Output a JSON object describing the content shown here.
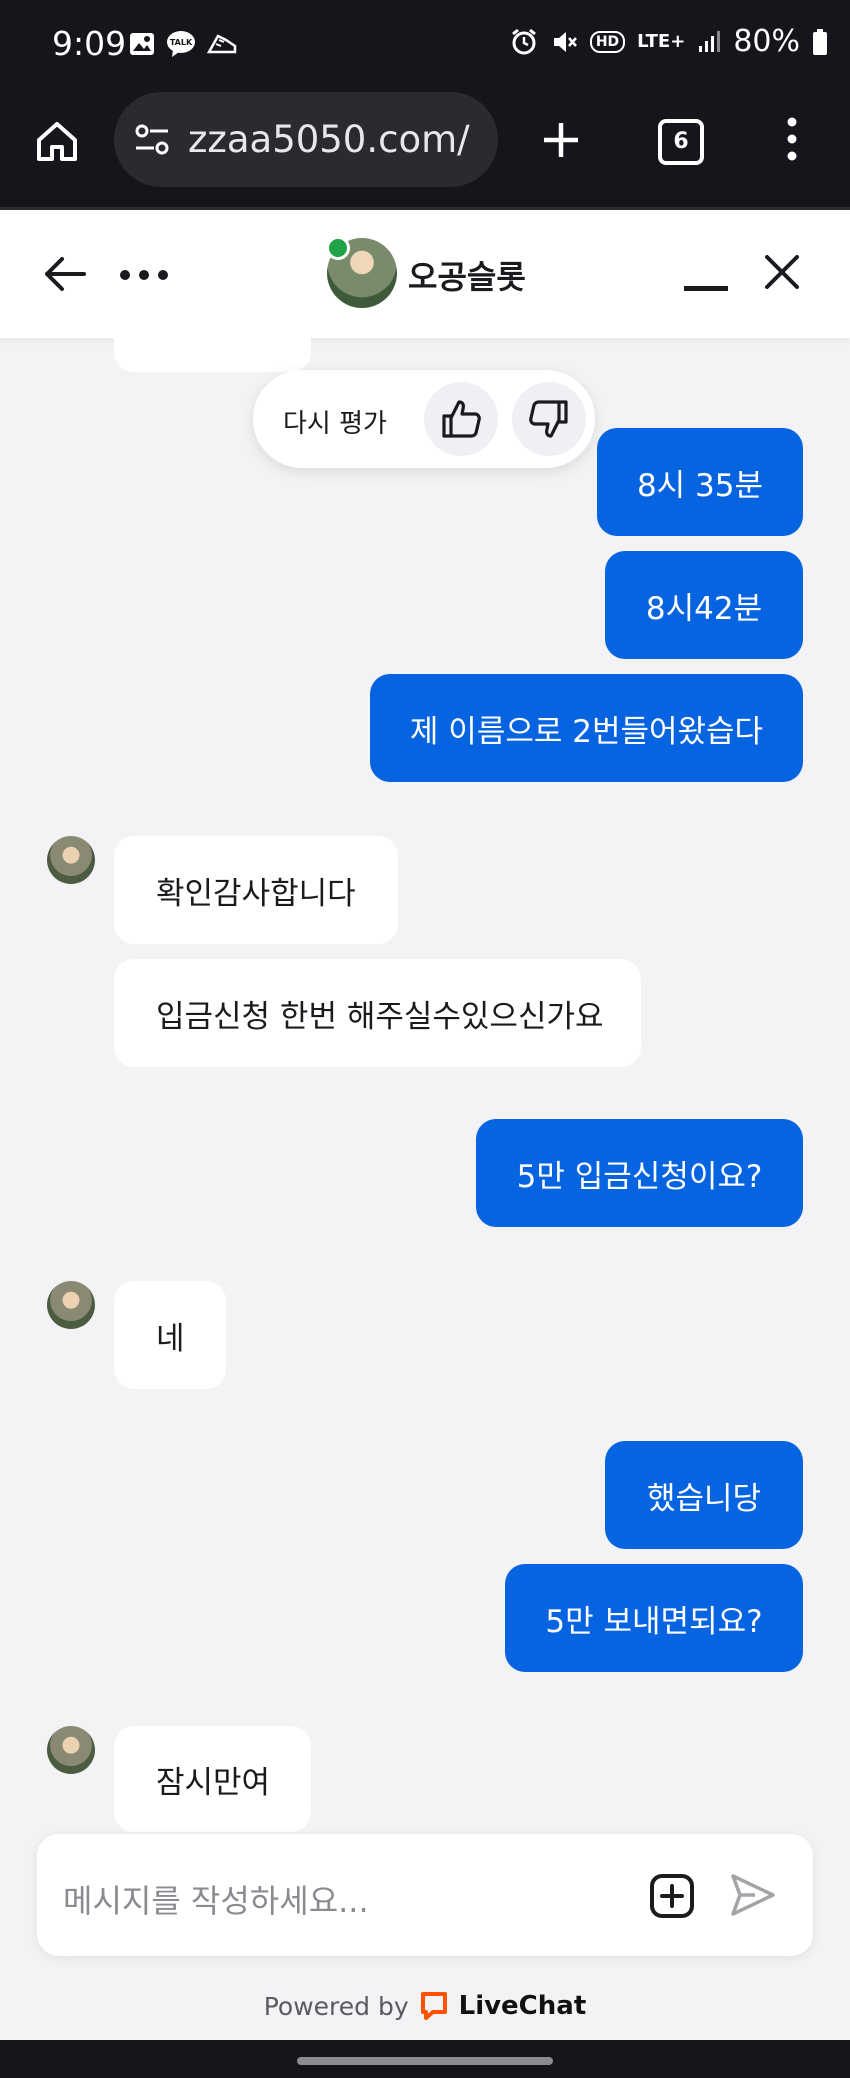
{
  "status": {
    "time": "9:09",
    "battery": "80%",
    "network": "LTE+",
    "hd": "HD"
  },
  "browser": {
    "url": "zzaa5050.com/",
    "tab_count": "6"
  },
  "header": {
    "agent_name": "오공슬롯"
  },
  "rating": {
    "label": "다시 평가"
  },
  "messages": {
    "m1": "8시 35분",
    "m2": "8시42분",
    "m3": "제 이름으로 2번들어왔습다",
    "m4": "확인감사합니다",
    "m5": "입금신청 한번 해주실수있으신가요",
    "m6": "5만 입금신청이요?",
    "m7": "네",
    "m8": "했습니당",
    "m9": "5만 보내면되요?",
    "m10": "잠시만여"
  },
  "composer": {
    "placeholder": "메시지를 작성하세요..."
  },
  "footer": {
    "powered_by": "Powered by",
    "brand": "LiveChat"
  },
  "colors": {
    "accent": "#0664e0",
    "header_dark": "#15161b",
    "online": "#21a34a",
    "livechat_orange": "#ff5100"
  }
}
